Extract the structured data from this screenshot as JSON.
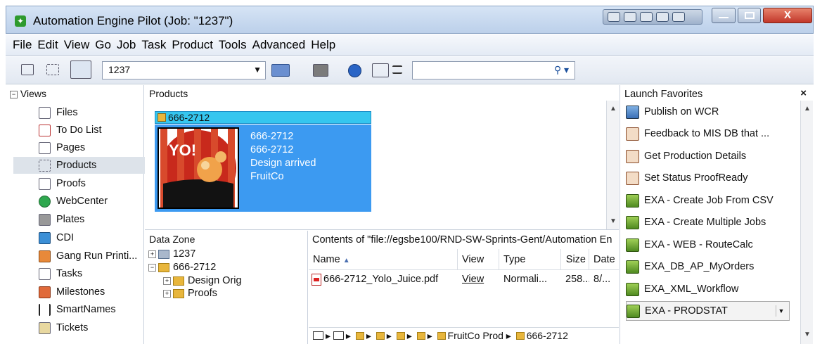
{
  "window": {
    "title": "Automation Engine Pilot (Job: \"1237\")",
    "close_glyph": "X"
  },
  "menu": [
    "File",
    "Edit",
    "View",
    "Go",
    "Job",
    "Task",
    "Product",
    "Tools",
    "Advanced",
    "Help"
  ],
  "toolbar": {
    "job_combo_value": "1237",
    "search_value": ""
  },
  "views": {
    "header": "Views",
    "items": [
      {
        "label": "Files",
        "icon": "file-icon"
      },
      {
        "label": "To Do List",
        "icon": "todo-icon"
      },
      {
        "label": "Pages",
        "icon": "pages-icon"
      },
      {
        "label": "Products",
        "icon": "products-icon",
        "selected": true
      },
      {
        "label": "Proofs",
        "icon": "proofs-icon"
      },
      {
        "label": "WebCenter",
        "icon": "webcenter-icon"
      },
      {
        "label": "Plates",
        "icon": "plates-icon"
      },
      {
        "label": "CDI",
        "icon": "cdi-icon"
      },
      {
        "label": "Gang Run Printi...",
        "icon": "gangrun-icon"
      },
      {
        "label": "Tasks",
        "icon": "tasks-icon"
      },
      {
        "label": "Milestones",
        "icon": "milestones-icon"
      },
      {
        "label": "SmartNames",
        "icon": "smartnames-icon"
      },
      {
        "label": "Tickets",
        "icon": "tickets-icon"
      }
    ]
  },
  "products": {
    "header": "Products",
    "card": {
      "title": "666-2712",
      "lines": [
        "666-2712",
        "666-2712",
        "Design arrived",
        "FruitCo"
      ],
      "thumb_text": "YO!"
    }
  },
  "datazone": {
    "header": "Data Zone",
    "nodes": [
      {
        "label": "1237",
        "expander": "+"
      },
      {
        "label": "666-2712",
        "expander": "−"
      },
      {
        "label": "Design Orig",
        "expander": "+"
      },
      {
        "label": "Proofs",
        "expander": "+"
      }
    ]
  },
  "contents": {
    "title": "Contents of \"file://egsbe100/RND-SW-Sprints-Gent/Automation En",
    "columns": {
      "name": "Name",
      "view": "View",
      "type": "Type",
      "size": "Size",
      "date": "Date"
    },
    "rows": [
      {
        "name": "666-2712_Yolo_Juice.pdf",
        "view": "View",
        "type": "Normali...",
        "size": "258...",
        "date": "8/..."
      }
    ],
    "path": {
      "segment1": "FruitCo Prod",
      "segment2": "666-2712"
    }
  },
  "favorites": {
    "header": "Launch Favorites",
    "close": "×",
    "items": [
      {
        "label": "Publish on WCR",
        "icon": "web-icon"
      },
      {
        "label": "Feedback to MIS DB that ...",
        "icon": "workflow-icon"
      },
      {
        "label": "Get Production Details",
        "icon": "workflow-icon"
      },
      {
        "label": "Set Status ProofReady",
        "icon": "workflow-icon"
      },
      {
        "label": "EXA - Create Job From CSV",
        "icon": "exa-icon"
      },
      {
        "label": "EXA - Create Multiple Jobs",
        "icon": "exa-icon"
      },
      {
        "label": "EXA - WEB - RouteCalc",
        "icon": "exa-icon"
      },
      {
        "label": "EXA_DB_AP_MyOrders",
        "icon": "exa-icon"
      },
      {
        "label": "EXA_XML_Workflow",
        "icon": "exa-icon"
      },
      {
        "label": "EXA - PRODSTAT",
        "icon": "exa-icon",
        "selected": true
      }
    ]
  }
}
